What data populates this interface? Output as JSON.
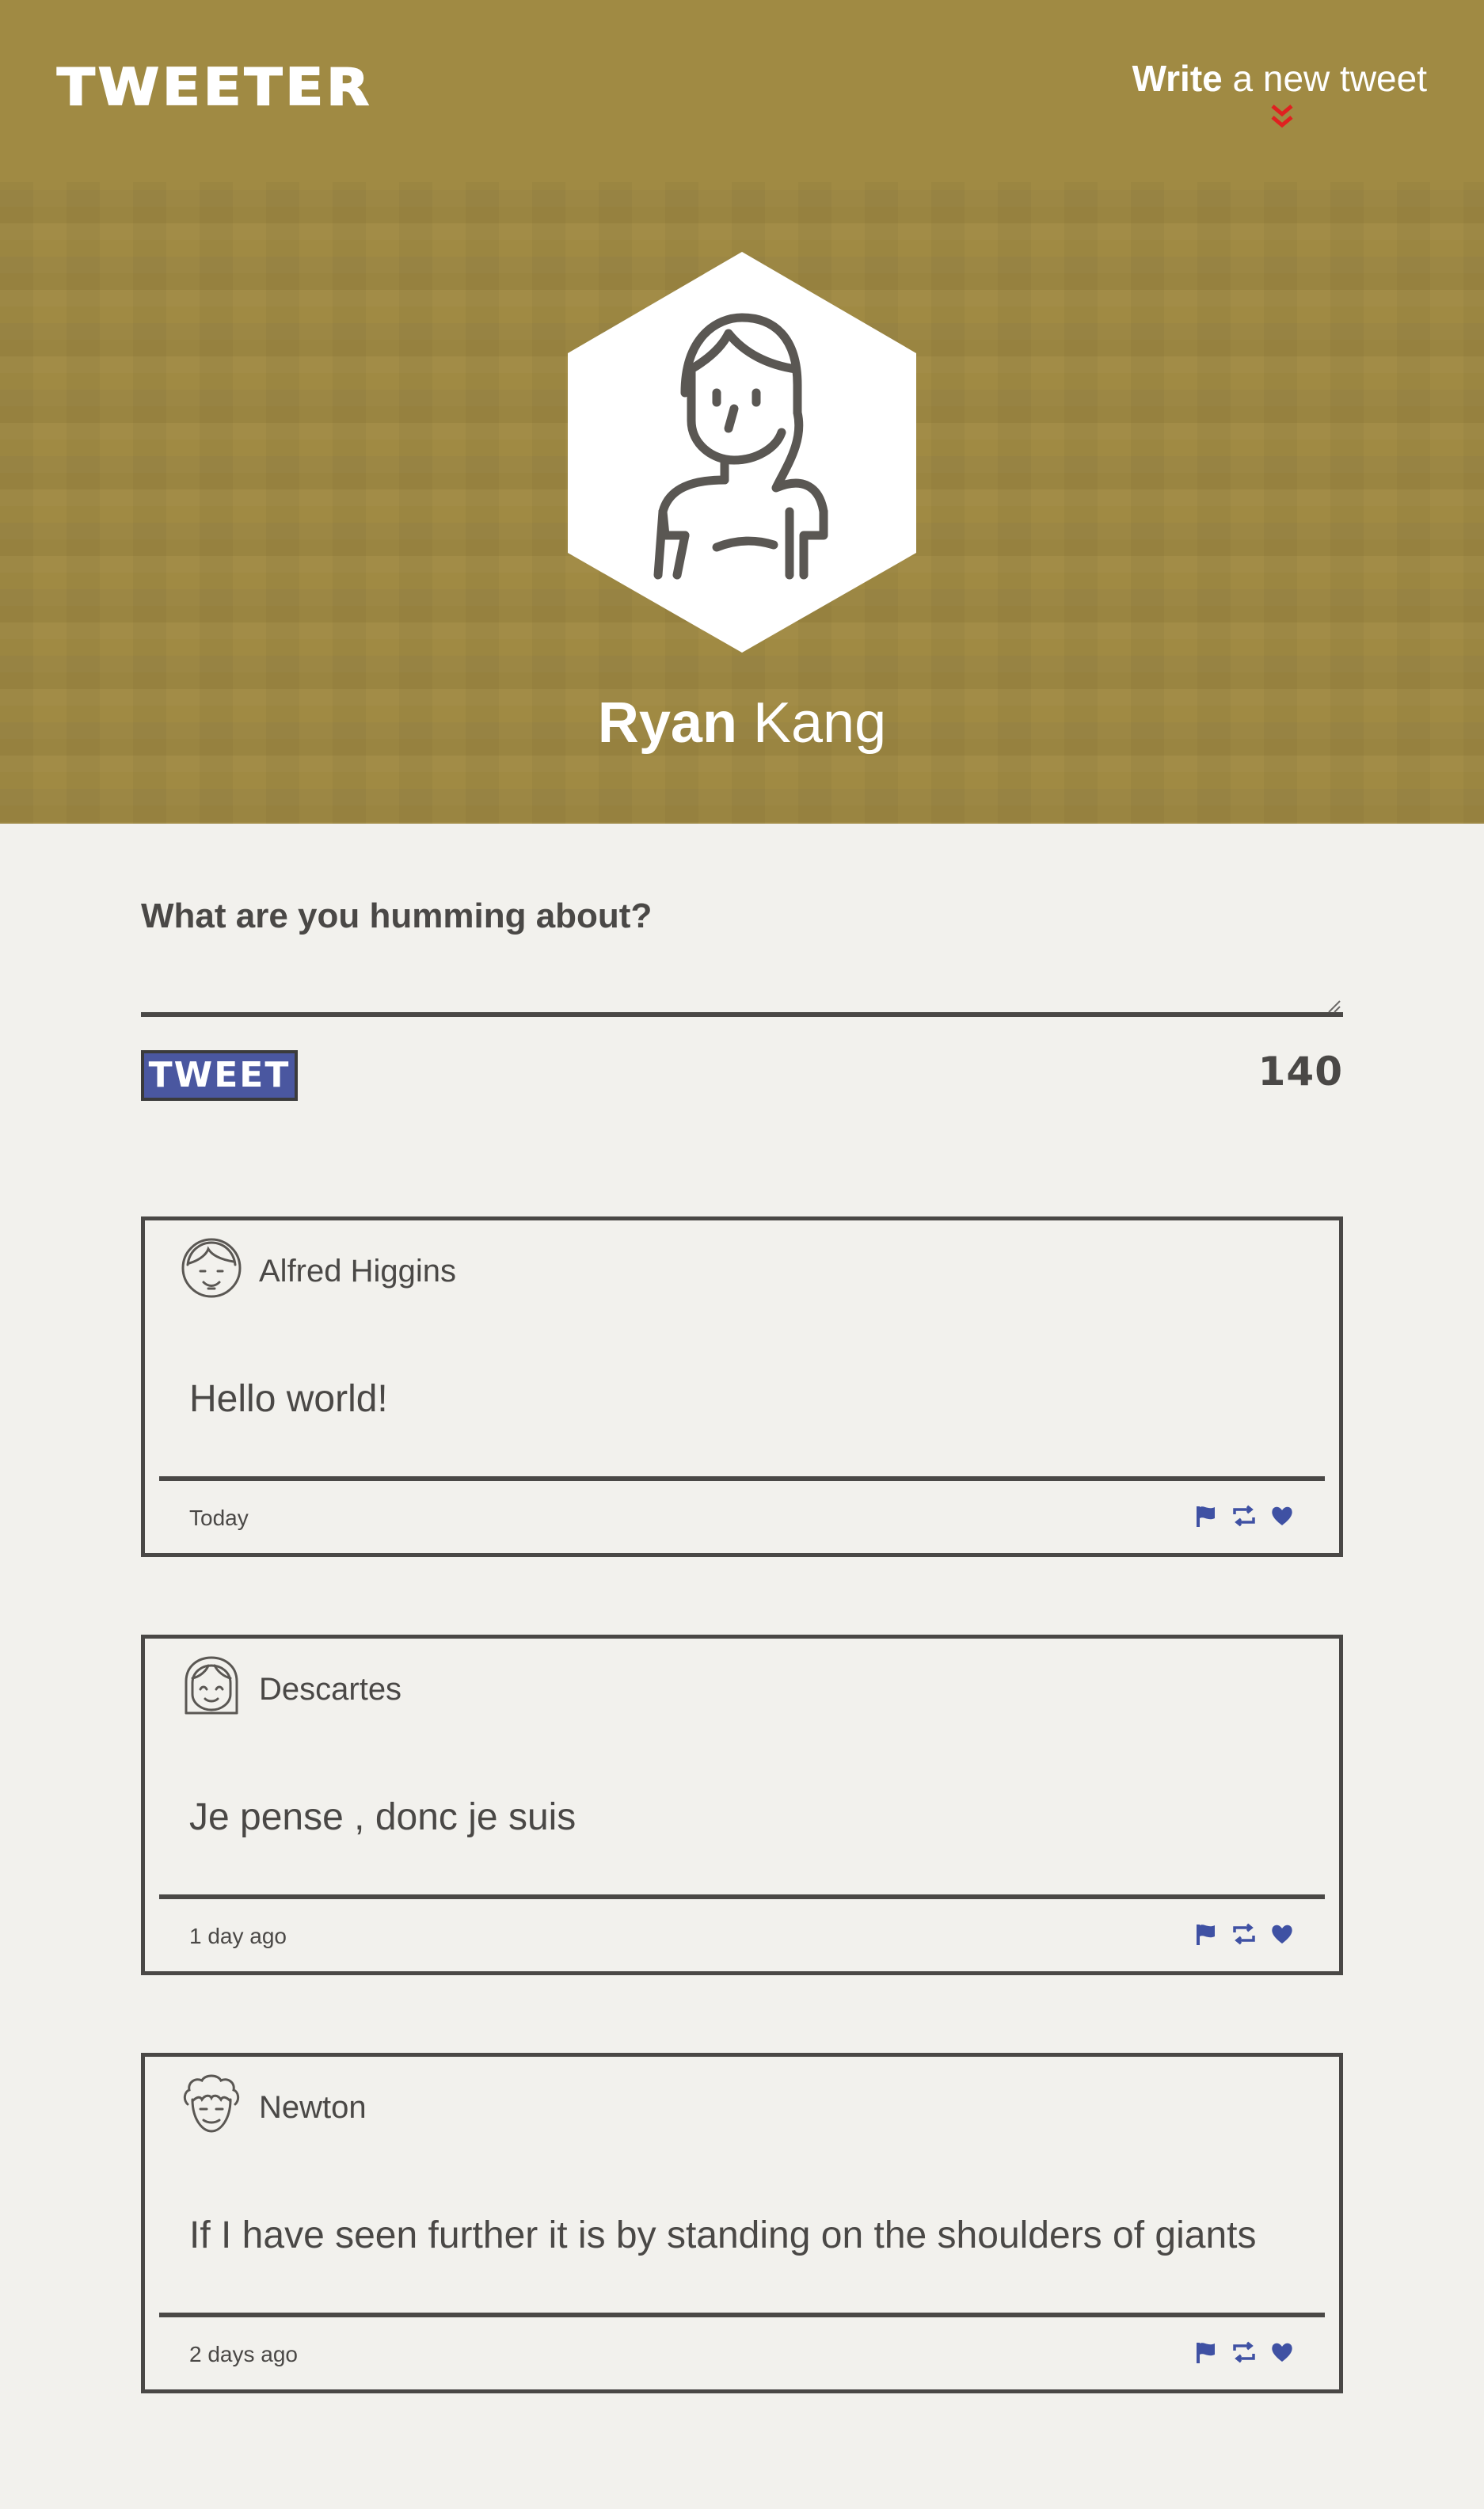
{
  "header": {
    "logo": "TWEETER",
    "compose_link": {
      "bold": "Write",
      "rest": " a new tweet"
    },
    "accent_color": "#e02020"
  },
  "profile": {
    "first_name": "Ryan",
    "last_name": " Kang"
  },
  "composer": {
    "label": "What are you humming about?",
    "value": "",
    "button_label": "TWEET",
    "counter": "140"
  },
  "tweets": [
    {
      "author": "Alfred Higgins",
      "text": "Hello world!",
      "time": "Today",
      "avatar": "boy-face-icon"
    },
    {
      "author": "Descartes",
      "text": "Je pense , donc je suis",
      "time": "1 day ago",
      "avatar": "girl-face-icon"
    },
    {
      "author": "Newton",
      "text": "If I have seen further it is by standing on the shoulders of giants",
      "time": "2 days ago",
      "avatar": "curly-hair-face-icon"
    }
  ],
  "actions": [
    "flag-icon",
    "retweet-icon",
    "heart-icon"
  ],
  "colors": {
    "header_bg": "#a08a43",
    "page_bg": "#f2f1ed",
    "text": "#4a4846",
    "button": "#4a57a0",
    "action_icons": "#3f51a3"
  }
}
